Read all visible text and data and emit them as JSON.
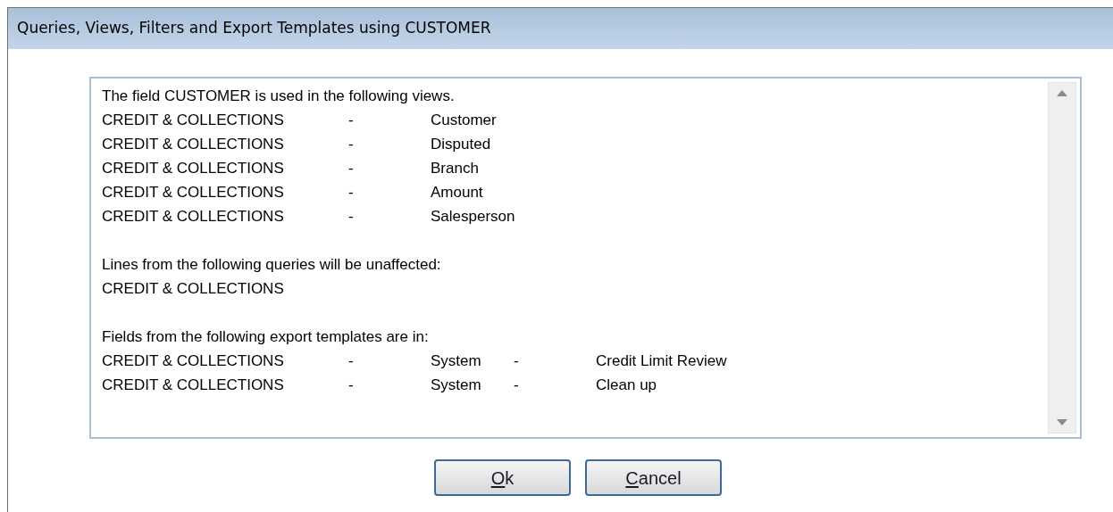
{
  "window": {
    "title": "Queries, Views, Filters and Export Templates using CUSTOMER"
  },
  "listing": [
    {
      "kind": "heading",
      "text": "The field CUSTOMER is used in the following views."
    },
    {
      "kind": "row",
      "cells": [
        "CREDIT & COLLECTIONS",
        "-",
        "Customer"
      ]
    },
    {
      "kind": "row",
      "cells": [
        "CREDIT & COLLECTIONS",
        "-",
        "Disputed"
      ]
    },
    {
      "kind": "row",
      "cells": [
        "CREDIT & COLLECTIONS",
        "-",
        "Branch"
      ]
    },
    {
      "kind": "row",
      "cells": [
        "CREDIT & COLLECTIONS",
        "-",
        "Amount"
      ]
    },
    {
      "kind": "row",
      "cells": [
        "CREDIT & COLLECTIONS",
        "-",
        "Salesperson"
      ]
    },
    {
      "kind": "gap"
    },
    {
      "kind": "heading",
      "text": "Lines from the following queries will be unaffected:"
    },
    {
      "kind": "row",
      "cells": [
        "CREDIT & COLLECTIONS"
      ]
    },
    {
      "kind": "gap"
    },
    {
      "kind": "heading",
      "text": "Fields from the following export templates are in:"
    },
    {
      "kind": "row",
      "cells": [
        "CREDIT & COLLECTIONS",
        "-",
        "System",
        "-",
        "Credit Limit Review"
      ]
    },
    {
      "kind": "row",
      "cells": [
        "CREDIT & COLLECTIONS",
        "-",
        "System",
        "-",
        "Clean up"
      ]
    }
  ],
  "buttons": [
    {
      "label": "Ok",
      "mnemonic_underlined": true
    },
    {
      "label": "Cancel",
      "mnemonic_underlined": true
    }
  ]
}
